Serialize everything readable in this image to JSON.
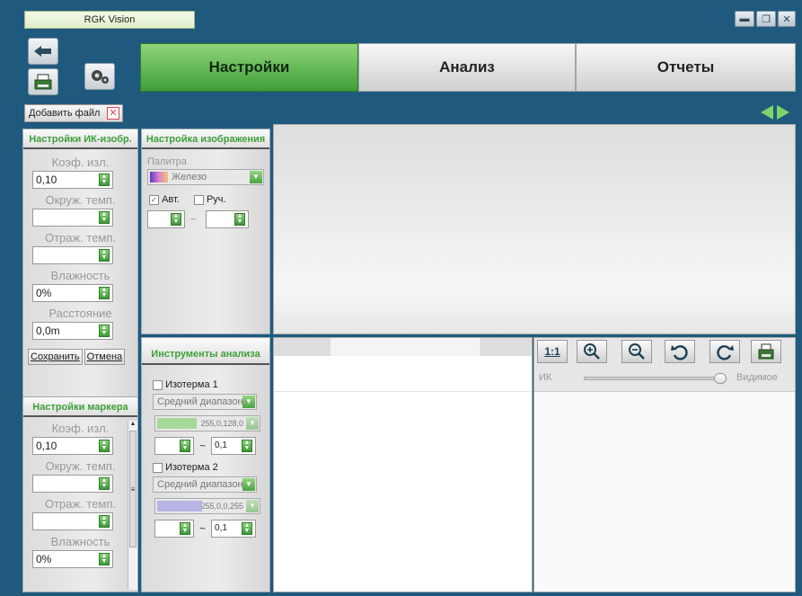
{
  "window": {
    "title": "RGK Vision"
  },
  "tabs": [
    {
      "label": "Настройки",
      "active": true
    },
    {
      "label": "Анализ",
      "active": false
    },
    {
      "label": "Отчеты",
      "active": false
    }
  ],
  "add_file": {
    "label": "Добавить файл"
  },
  "ir_settings": {
    "title": "Настройки ИК-изобр.",
    "emissivity": {
      "label": "Коэф. изл.",
      "value": "0,10"
    },
    "ambient_temp": {
      "label": "Окруж. темп.",
      "value": ""
    },
    "reflected_temp": {
      "label": "Отраж. темп.",
      "value": ""
    },
    "humidity": {
      "label": "Влажность",
      "value": "0%"
    },
    "distance": {
      "label": "Расстояние",
      "value": "0,0m"
    },
    "save_label": "Сохранить",
    "cancel_label": "Отмена"
  },
  "marker_settings": {
    "title": "Настройки маркера",
    "emissivity": {
      "label": "Коэф. изл.",
      "value": "0,10"
    },
    "ambient_temp": {
      "label": "Окруж. темп.",
      "value": ""
    },
    "reflected_temp": {
      "label": "Отраж. темп.",
      "value": ""
    },
    "humidity": {
      "label": "Влажность",
      "value": "0%"
    }
  },
  "image_settings": {
    "title": "Настройка изображения",
    "palette_label": "Палитра",
    "palette_value": "Железо",
    "auto_label": "Авт.",
    "auto_checked": true,
    "manual_label": "Руч.",
    "manual_checked": false,
    "range_sep": "~"
  },
  "analysis_tools": {
    "title": "Инструменты анализа",
    "isotherm1": {
      "label": "Изотерма 1",
      "mode": "Средний диапазон",
      "color_value": "255,0,128,0",
      "color_hex": "#a6d89a",
      "threshold": "0,1"
    },
    "isotherm2": {
      "label": "Изотерма 2",
      "mode": "Средний диапазон",
      "color_value": "255,0,0,255",
      "color_hex": "#b7b4e6",
      "threshold": "0,1"
    },
    "range_sep": "~"
  },
  "viewer": {
    "zoom_label": "1:1",
    "ir_label": "ИК",
    "visible_label": "Видимое",
    "blend_level": 1.0
  },
  "icons": {
    "back": "hand-arrow-icon",
    "print": "printer-icon",
    "settings": "gears-icon",
    "nav": "left-right-arrows-icon",
    "zoom_in": "zoom-in-icon",
    "zoom_out": "zoom-out-icon",
    "rotate_left": "rotate-left-icon",
    "rotate_right": "rotate-right-icon",
    "save": "save-icon"
  },
  "colors": {
    "accent": "#4aa343",
    "background": "#1f5a7e",
    "tab_active": "#5fbf52"
  }
}
